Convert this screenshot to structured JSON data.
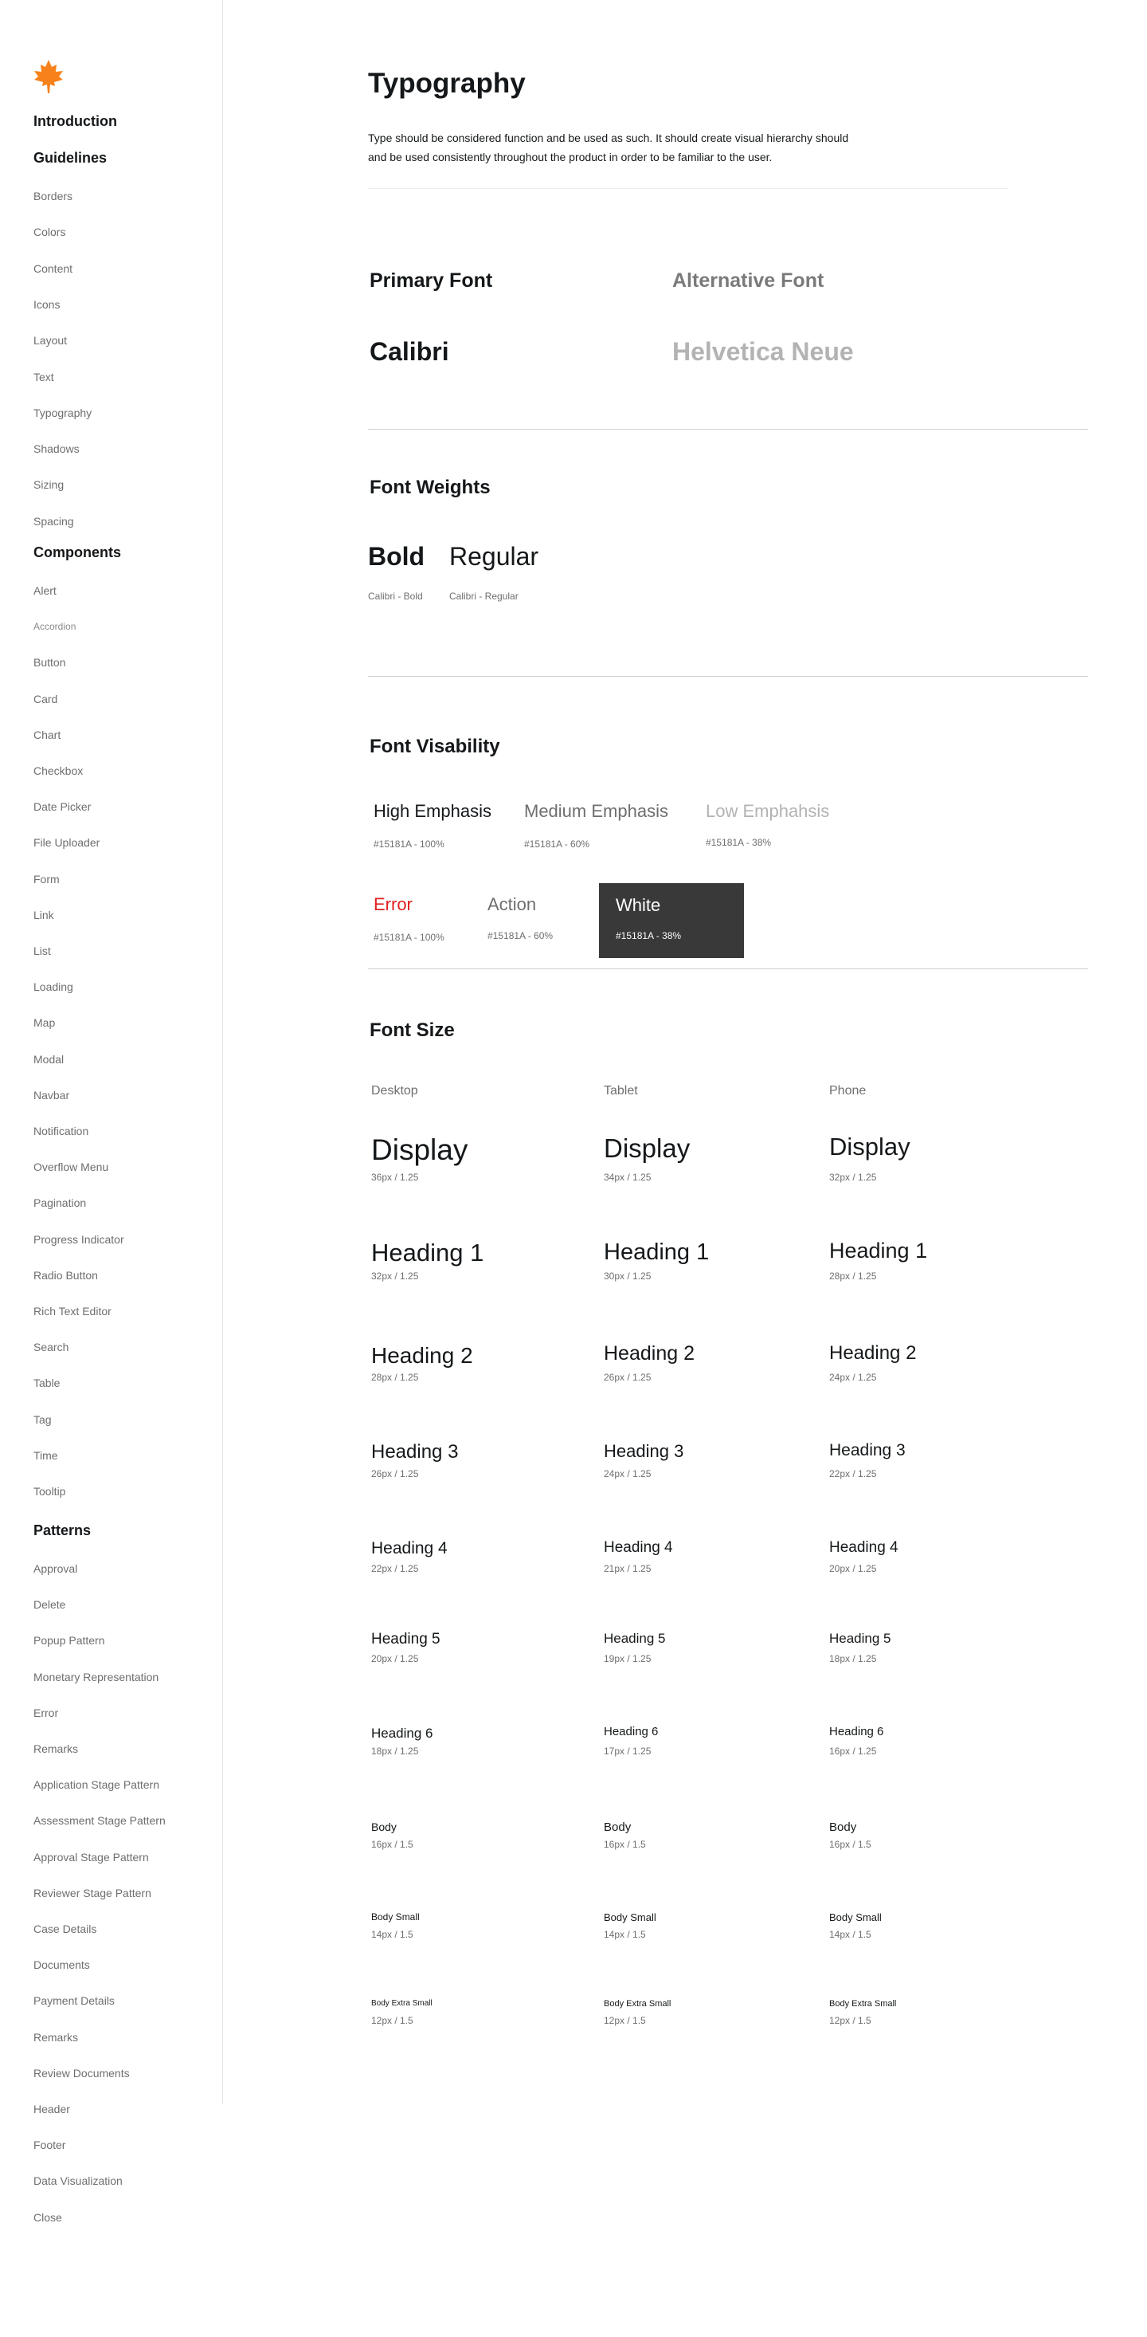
{
  "sidebar": {
    "logo_icon": "maple-leaf-icon",
    "logo_color": "#F7821B",
    "introduction": "Introduction",
    "guidelines_heading": "Guidelines",
    "guidelines": [
      "Borders",
      "Colors",
      "Content",
      "Icons",
      "Layout",
      "Text",
      "Typography",
      "Shadows",
      "Sizing",
      "Spacing"
    ],
    "components_heading": "Components",
    "components": [
      "Alert",
      "Accordion",
      "Button",
      "Card",
      "Chart",
      "Checkbox",
      "Date Picker",
      "File Uploader",
      "Form",
      "Link",
      "List",
      "Loading",
      "Map",
      "Modal",
      "Navbar",
      "Notification",
      "Overflow Menu",
      "Pagination",
      "Progress Indicator",
      "Radio Button",
      "Rich Text Editor",
      "Search",
      "Table",
      "Tag",
      "Time",
      "Tooltip"
    ],
    "patterns_heading": "Patterns",
    "patterns": [
      "Approval",
      "Delete",
      "Popup Pattern",
      "Monetary Representation",
      "Error",
      "Remarks",
      "Application Stage Pattern",
      "Assessment Stage Pattern",
      "Approval Stage Pattern",
      "Reviewer Stage Pattern",
      "Case Details",
      "Documents",
      "Payment Details",
      "Remarks",
      "Review Documents",
      "Header",
      "Footer",
      "Data Visualization",
      "Close"
    ]
  },
  "main": {
    "title": "Typography",
    "intro": "Type should be considered function and be used as such. It should create visual hierarchy should and be used consistently throughout the product in order to be familiar to the user.",
    "fonts": {
      "primary_label": "Primary Font",
      "alternative_label": "Alternative Font",
      "primary_name": "Calibri",
      "alternative_name": "Helvetica Neue"
    },
    "weights": {
      "title": "Font Weights",
      "bold": "Bold",
      "regular": "Regular",
      "bold_caption": "Calibri - Bold",
      "regular_caption": "Calibri - Regular"
    },
    "visibility": {
      "title": "Font Visability",
      "high": "High Emphasis",
      "high_caption": "#15181A - 100%",
      "medium": "Medium Emphasis",
      "medium_caption": "#15181A - 60%",
      "low": "Low Emphahsis",
      "low_caption": "#15181A - 38%",
      "error": "Error",
      "error_caption": "#15181A - 100%",
      "error_color": "#E02020",
      "action": "Action",
      "action_caption": "#15181A - 60%",
      "white": "White",
      "white_caption": "#15181A - 38%",
      "card_color": "#393939"
    },
    "size": {
      "title": "Font Size",
      "columns": [
        "Desktop",
        "Tablet",
        "Phone"
      ],
      "rows": [
        {
          "label": "Display",
          "specs": [
            "36px / 1.25",
            "34px / 1.25",
            "32px / 1.25"
          ]
        },
        {
          "label": "Heading 1",
          "specs": [
            "32px / 1.25",
            "30px / 1.25",
            "28px / 1.25"
          ]
        },
        {
          "label": "Heading 2",
          "specs": [
            "28px / 1.25",
            "26px / 1.25",
            "24px / 1.25"
          ]
        },
        {
          "label": "Heading 3",
          "specs": [
            "26px / 1.25",
            "24px / 1.25",
            "22px / 1.25"
          ]
        },
        {
          "label": "Heading 4",
          "specs": [
            "22px / 1.25",
            "21px / 1.25",
            "20px / 1.25"
          ]
        },
        {
          "label": "Heading 5",
          "specs": [
            "20px / 1.25",
            "19px / 1.25",
            "18px / 1.25"
          ]
        },
        {
          "label": "Heading 6",
          "specs": [
            "18px / 1.25",
            "17px / 1.25",
            "16px / 1.25"
          ]
        },
        {
          "label": "Body",
          "specs": [
            "16px / 1.5",
            "16px / 1.5",
            "16px / 1.5"
          ]
        },
        {
          "label": "Body Small",
          "specs": [
            "14px / 1.5",
            "14px / 1.5",
            "14px / 1.5"
          ]
        },
        {
          "label": "Body Extra Small",
          "specs": [
            "12px / 1.5",
            "12px / 1.5",
            "12px / 1.5"
          ]
        }
      ]
    }
  }
}
